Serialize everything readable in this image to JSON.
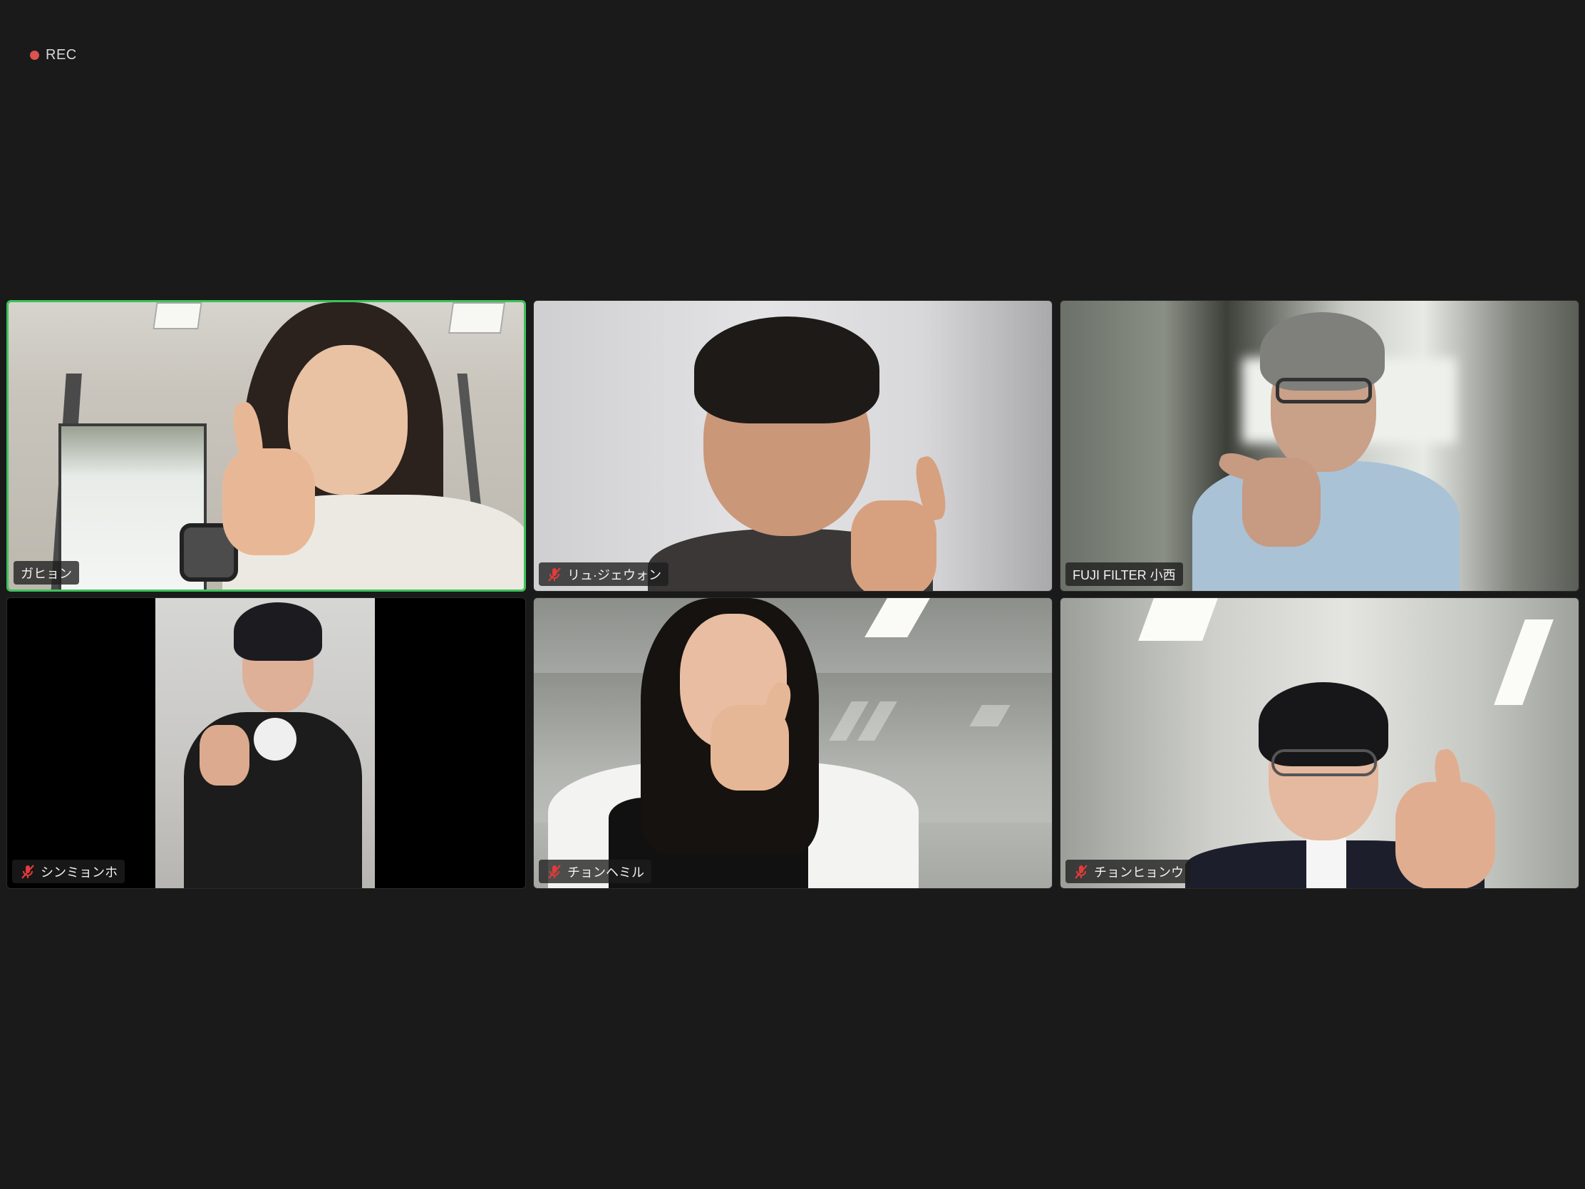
{
  "recording": {
    "label": "REC",
    "indicator_color": "#d9534f"
  },
  "theme": {
    "background": "#1a1a1a",
    "active_speaker_border": "#3ec15a",
    "muted_icon_color": "#e23b3b"
  },
  "participants": [
    {
      "name": "ガヒョン",
      "muted": false,
      "active_speaker": true
    },
    {
      "name": "リュ·ジェウォン",
      "muted": true,
      "active_speaker": false
    },
    {
      "name": "FUJI FILTER 小西",
      "muted": false,
      "active_speaker": false
    },
    {
      "name": "シンミョンホ",
      "muted": true,
      "active_speaker": false
    },
    {
      "name": "チョンヘミル",
      "muted": true,
      "active_speaker": false
    },
    {
      "name": "チョンヒョンウ",
      "muted": true,
      "active_speaker": false
    }
  ],
  "icons": {
    "muted": "microphone-off-icon",
    "recording": "recording-dot-icon"
  }
}
